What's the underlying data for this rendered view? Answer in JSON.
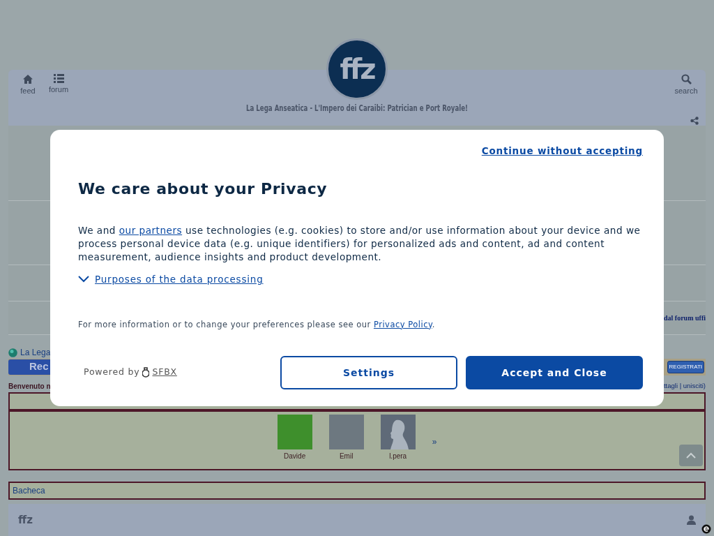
{
  "header": {
    "logo": "ffz",
    "nav_left": [
      {
        "label": "feed",
        "kind": "home"
      },
      {
        "label": "forum",
        "kind": "list"
      }
    ],
    "nav_right": [
      {
        "label": "search",
        "kind": "search"
      }
    ],
    "title": "La Lega Anseatica - L'Impero dei Caraibi: Patrician e Port Royale!"
  },
  "page": {
    "announcement_fragment": "dal forum uffi",
    "breadcrumb": "La Lega",
    "register_banner": "Rec",
    "register_button": "REGISTRATI",
    "welcome_fragment": "Benvenuto n",
    "login_links_fragment": "ttagli | unisciti)",
    "top_users": [
      {
        "name": "Davide",
        "kind": "cartoon"
      },
      {
        "name": "Emil",
        "kind": "photo"
      },
      {
        "name": "l.pera",
        "kind": "silhouette"
      }
    ],
    "more_link": "»",
    "board_link": "Bacheca"
  },
  "footer": {
    "logo": "ffz"
  },
  "consent": {
    "continue_link": "Continue without accepting",
    "title": "We care about your Privacy",
    "body": {
      "before": "We and ",
      "link": "our partners",
      "after": " use technologies (e.g. cookies) to store and/or use information about your device and we process personal device data (e.g. unique identifiers) for personalized ads and content, ad and content measurement, audience insights and product development."
    },
    "purposes": {
      "label": "Purposes of the data processing",
      "expanded": false
    },
    "info": {
      "before": "For more information or to change your preferences please see our ",
      "link": "Privacy Policy",
      "after": "."
    },
    "powered_by": "Powered by",
    "brand": "SFBX",
    "buttons": [
      {
        "label": "Settings",
        "kind": "outline"
      },
      {
        "label": "Accept and Close",
        "kind": "primary"
      }
    ]
  }
}
